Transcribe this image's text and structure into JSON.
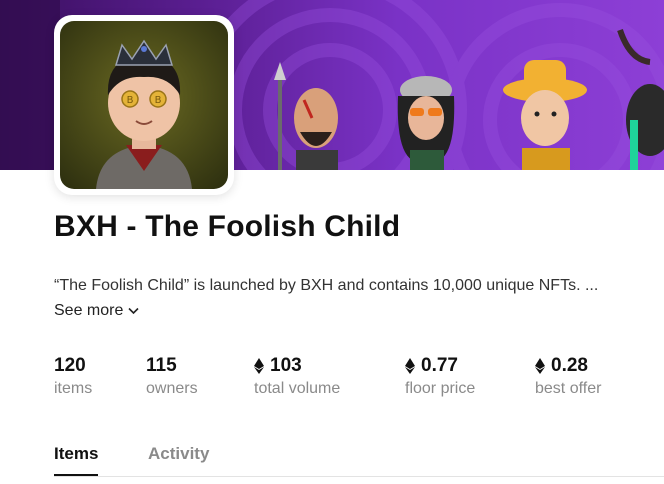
{
  "collection": {
    "title": "BXH - The Foolish Child",
    "description": "“The Foolish Child” is launched by BXH and contains 10,000 unique NFTs. ...",
    "see_more_label": "See more"
  },
  "stats": [
    {
      "value": "120",
      "label": "items",
      "icon": ""
    },
    {
      "value": "115",
      "label": "owners",
      "icon": ""
    },
    {
      "value": "103",
      "label": "total volume",
      "icon": "eth-icon"
    },
    {
      "value": "0.77",
      "label": "floor price",
      "icon": "eth-icon"
    },
    {
      "value": "0.28",
      "label": "best offer",
      "icon": "eth-icon"
    }
  ],
  "tabs": [
    {
      "label": "Items",
      "active": true
    },
    {
      "label": "Activity",
      "active": false
    }
  ],
  "colors": {
    "banner_purple": "#7a32c6",
    "text_primary": "#111111",
    "text_muted": "#8a8a8a"
  }
}
